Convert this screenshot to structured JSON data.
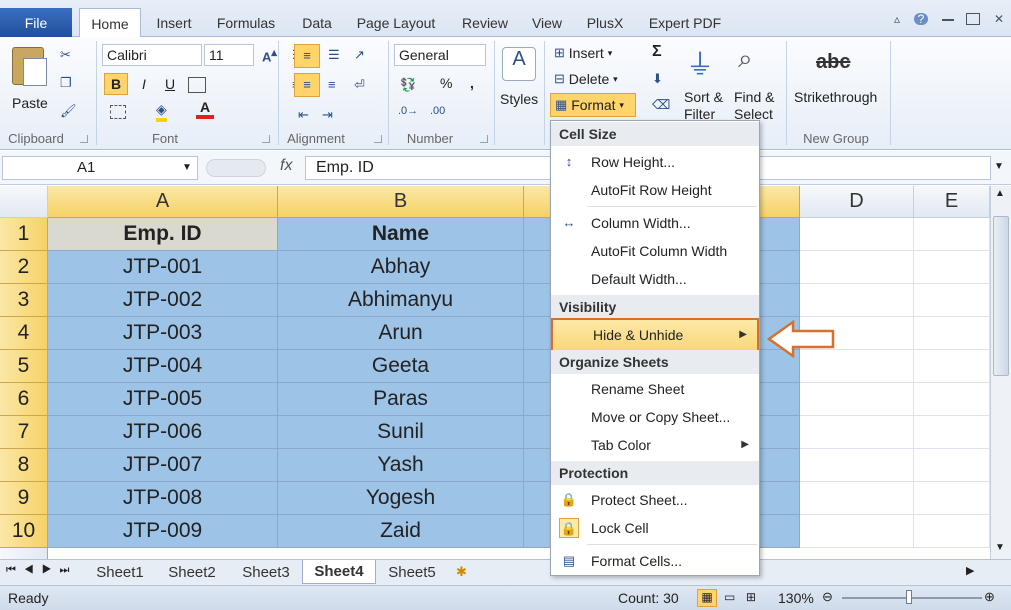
{
  "ribbon_tabs": {
    "file": "File",
    "home": "Home",
    "insert": "Insert",
    "formulas": "Formulas",
    "data": "Data",
    "page_layout": "Page Layout",
    "review": "Review",
    "view": "View",
    "plusx": "PlusX",
    "expert_pdf": "Expert PDF"
  },
  "clipboard": {
    "paste": "Paste",
    "label": "Clipboard"
  },
  "font": {
    "name": "Calibri",
    "size": "11",
    "label": "Font",
    "bold": "B",
    "italic": "I",
    "underline": "U",
    "font_color_letter": "A"
  },
  "alignment": {
    "label": "Alignment"
  },
  "number": {
    "format": "General",
    "label": "Number",
    "percent": "%",
    "comma": ","
  },
  "styles": {
    "label": "Styles"
  },
  "cells": {
    "insert": "Insert",
    "delete": "Delete",
    "format": "Format"
  },
  "editing": {
    "sort_filter": "Sort & Filter",
    "find_select": "Find & Select",
    "sigma": "Σ"
  },
  "new_group": {
    "strikethrough_icon_text": "abc",
    "strikethrough": "Strikethrough",
    "label": "New Group"
  },
  "formula_bar": {
    "name_box": "A1",
    "fx": "fx",
    "content": "Emp. ID"
  },
  "columns": [
    "A",
    "B",
    "D",
    "E"
  ],
  "rows": [
    "1",
    "2",
    "3",
    "4",
    "5",
    "6",
    "7",
    "8",
    "9",
    "10"
  ],
  "table": [
    {
      "id": "Emp. ID",
      "name": "Name"
    },
    {
      "id": "JTP-001",
      "name": "Abhay"
    },
    {
      "id": "JTP-002",
      "name": "Abhimanyu"
    },
    {
      "id": "JTP-003",
      "name": "Arun"
    },
    {
      "id": "JTP-004",
      "name": "Geeta"
    },
    {
      "id": "JTP-005",
      "name": "Paras"
    },
    {
      "id": "JTP-006",
      "name": "Sunil"
    },
    {
      "id": "JTP-007",
      "name": "Yash"
    },
    {
      "id": "JTP-008",
      "name": "Yogesh"
    },
    {
      "id": "JTP-009",
      "name": "Zaid"
    }
  ],
  "menu": {
    "cell_size": "Cell Size",
    "row_height": "Row Height...",
    "autofit_row": "AutoFit Row Height",
    "column_width": "Column Width...",
    "autofit_col": "AutoFit Column Width",
    "default_width": "Default Width...",
    "visibility": "Visibility",
    "hide_unhide": "Hide & Unhide",
    "organize": "Organize Sheets",
    "rename": "Rename Sheet",
    "move_copy": "Move or Copy Sheet...",
    "tab_color": "Tab Color",
    "protection": "Protection",
    "protect_sheet": "Protect Sheet...",
    "lock_cell": "Lock Cell",
    "format_cells": "Format Cells..."
  },
  "sheets": [
    "Sheet1",
    "Sheet2",
    "Sheet3",
    "Sheet4",
    "Sheet5"
  ],
  "status": {
    "ready": "Ready",
    "count": "Count: 30",
    "zoom": "130%"
  },
  "colors": {
    "selection_fill": "#9dc3e6",
    "header_highlight": "#f6d267",
    "callout": "#d9702a"
  }
}
